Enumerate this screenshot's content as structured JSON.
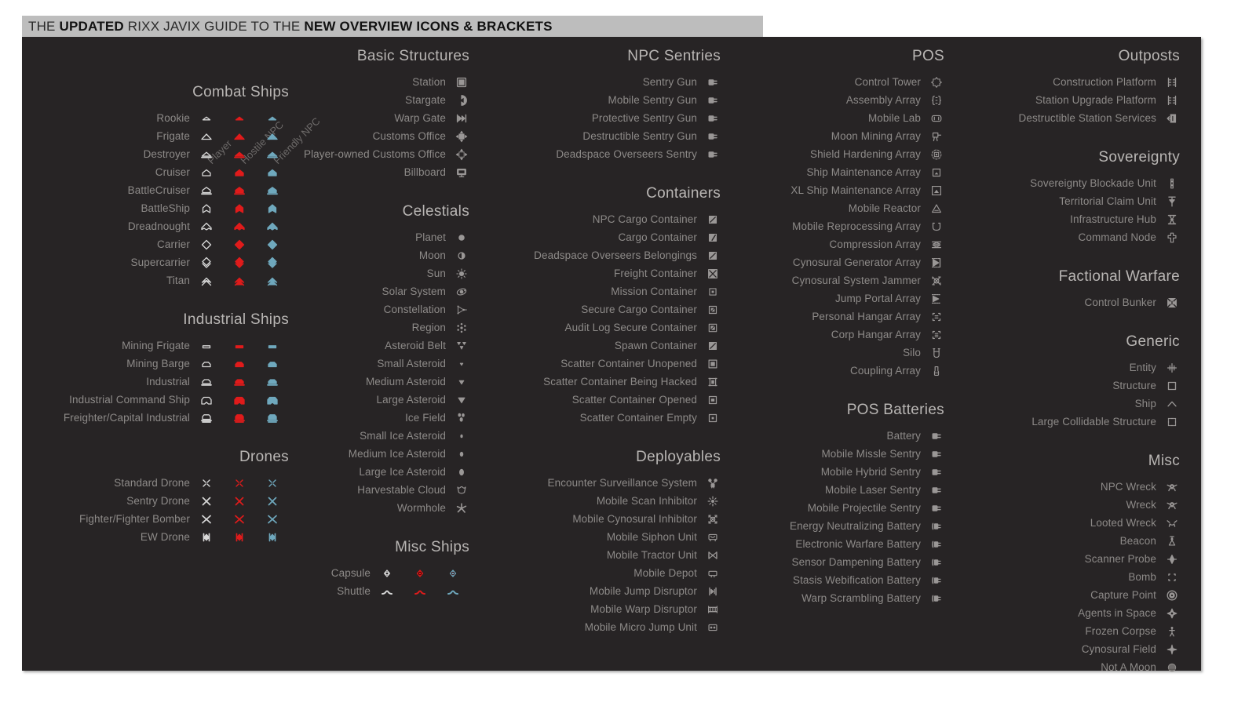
{
  "banner": {
    "prefix": "THE ",
    "bold1": "UPDATED",
    "mid": " RIXX JAVIX GUIDE TO THE ",
    "bold2": "NEW OVERVIEW ICONS & BRACKETS"
  },
  "colors": {
    "player": "#d8d8d8",
    "hostile": "#e01b1b",
    "friendly": "#6fa8bd",
    "icon": "#9a9796",
    "section_title": "#b9b6b4",
    "label": "#8d8a88",
    "panel_bg": "#272425",
    "banner_bg": "#bdbdbd",
    "page_bg": "#ffffff"
  },
  "column_headers": [
    "Player",
    "Hostile NPC",
    "Friendly NPC"
  ],
  "columns": {
    "ships": [
      {
        "title": "Combat Ships",
        "type": "triple",
        "items": [
          "Rookie",
          "Frigate",
          "Destroyer",
          "Cruiser",
          "BattleCruiser",
          "BattleShip",
          "Dreadnought",
          "Carrier",
          "Supercarrier",
          "Titan"
        ]
      },
      {
        "title": "Industrial Ships",
        "type": "triple",
        "items": [
          "Mining Frigate",
          "Mining Barge",
          "Industrial",
          "Industrial Command Ship",
          "Freighter/Capital Industrial"
        ]
      },
      {
        "title": "Drones",
        "type": "triple",
        "items": [
          "Standard Drone",
          "Sentry Drone",
          "Fighter/Fighter Bomber",
          "EW Drone"
        ]
      }
    ],
    "structures": [
      {
        "title": "Basic Structures",
        "type": "single",
        "items": [
          "Station",
          "Stargate",
          "Warp Gate",
          "Customs Office",
          "Player-owned Customs Office",
          "Billboard"
        ]
      },
      {
        "title": "Celestials",
        "type": "single",
        "items": [
          "Planet",
          "Moon",
          "Sun",
          "Solar System",
          "Constellation",
          "Region",
          "Asteroid Belt",
          "Small Asteroid",
          "Medium Asteroid",
          "Large Asteroid",
          "Ice Field",
          "Small Ice Asteroid",
          "Medium Ice Asteroid",
          "Large Ice Asteroid",
          "Harvestable Cloud",
          "Wormhole"
        ]
      },
      {
        "title": "Misc Ships",
        "type": "triple",
        "items": [
          "Capsule",
          "Shuttle"
        ]
      }
    ],
    "npc": [
      {
        "title": "NPC Sentries",
        "type": "single",
        "items": [
          "Sentry Gun",
          "Mobile Sentry Gun",
          "Protective Sentry Gun",
          "Destructible Sentry Gun",
          "Deadspace Overseers Sentry"
        ]
      },
      {
        "title": "Containers",
        "type": "single",
        "items": [
          "NPC Cargo Container",
          "Cargo Container",
          "Deadspace Overseers Belongings",
          "Freight Container",
          "Mission Container",
          "Secure Cargo Container",
          "Audit Log Secure Container",
          "Spawn Container",
          "Scatter Container Unopened",
          "Scatter Container Being Hacked",
          "Scatter Container Opened",
          "Scatter Container Empty"
        ]
      },
      {
        "title": "Deployables",
        "type": "single",
        "items": [
          "Encounter Surveillance System",
          "Mobile Scan Inhibitor",
          "Mobile Cynosural Inhibitor",
          "Mobile Siphon Unit",
          "Mobile Tractor Unit",
          "Mobile Depot",
          "Mobile Jump Disruptor",
          "Mobile Warp Disruptor",
          "Mobile Micro Jump Unit"
        ]
      }
    ],
    "pos": [
      {
        "title": "POS",
        "type": "single",
        "items": [
          "Control Tower",
          "Assembly Array",
          "Mobile Lab",
          "Moon Mining Array",
          "Shield Hardening Array",
          "Ship Maintenance Array",
          "XL Ship Maintenance Array",
          "Mobile Reactor",
          "Mobile Reprocessing Array",
          "Compression Array",
          "Cynosural Generator Array",
          "Cynosural System Jammer",
          "Jump Portal Array",
          "Personal Hangar Array",
          "Corp Hangar Array",
          "Silo",
          "Coupling Array"
        ]
      },
      {
        "title": "POS Batteries",
        "type": "single",
        "items": [
          "Battery",
          "Mobile Missle Sentry",
          "Mobile Hybrid Sentry",
          "Mobile Laser Sentry",
          "Mobile Projectile Sentry",
          "Energy Neutralizing Battery",
          "Electronic Warfare Battery",
          "Sensor Dampening Battery",
          "Stasis Webification Battery",
          "Warp Scrambling Battery"
        ]
      }
    ],
    "sov": [
      {
        "title": "Outposts",
        "type": "single",
        "items": [
          "Construction Platform",
          "Station Upgrade Platform",
          "Destructible Station Services"
        ]
      },
      {
        "title": "Sovereignty",
        "type": "single",
        "items": [
          "Sovereignty Blockade Unit",
          "Territorial Claim Unit",
          "Infrastructure Hub",
          "Command Node"
        ]
      },
      {
        "title": "Factional Warfare",
        "type": "single",
        "items": [
          "Control Bunker"
        ]
      },
      {
        "title": "Generic",
        "type": "single",
        "items": [
          "Entity",
          "Structure",
          "Ship",
          "Large Collidable Structure"
        ]
      },
      {
        "title": "Misc",
        "type": "single",
        "items": [
          "NPC Wreck",
          "Wreck",
          "Looted Wreck",
          "Beacon",
          "Scanner Probe",
          "Bomb",
          "Capture Point",
          "Agents in Space",
          "Frozen Corpse",
          "Cynosural Field",
          "Not A Moon"
        ]
      }
    ]
  }
}
